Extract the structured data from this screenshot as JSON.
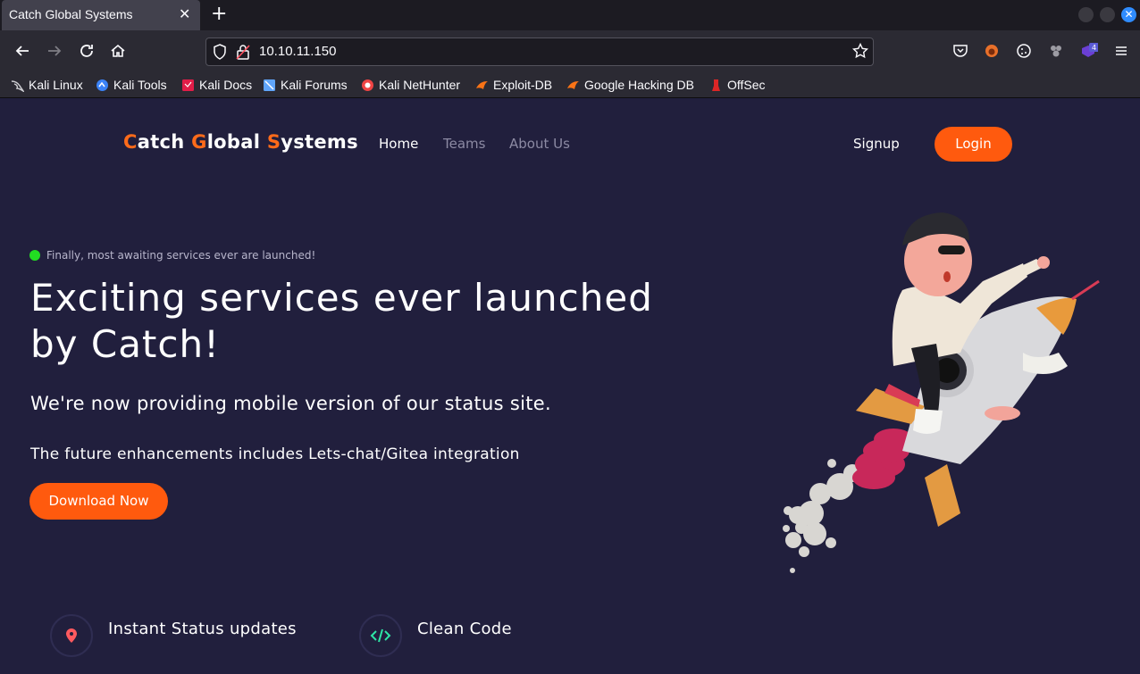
{
  "browser": {
    "tab_title": "Catch Global Systems",
    "tab_close": "✕",
    "new_tab": "+",
    "url": "10.10.11.150",
    "extension_badge": "4",
    "bookmarks": [
      {
        "label": "Kali Linux",
        "icon": "kali-dragon-icon",
        "color": "#cccccc"
      },
      {
        "label": "Kali Tools",
        "icon": "kali-tools-icon",
        "color": "#3b82f6"
      },
      {
        "label": "Kali Docs",
        "icon": "kali-docs-icon",
        "color": "#e11d48"
      },
      {
        "label": "Kali Forums",
        "icon": "kali-forums-icon",
        "color": "#60a5fa"
      },
      {
        "label": "Kali NetHunter",
        "icon": "nethunter-icon",
        "color": "#ef4444"
      },
      {
        "label": "Exploit-DB",
        "icon": "exploitdb-icon",
        "color": "#f97316"
      },
      {
        "label": "Google Hacking DB",
        "icon": "ghdb-icon",
        "color": "#f97316"
      },
      {
        "label": "OffSec",
        "icon": "offsec-icon",
        "color": "#dc2626"
      }
    ]
  },
  "site": {
    "brand": {
      "c1": "C",
      "r1": "atch ",
      "c2": "G",
      "r2": "lobal ",
      "c3": "S",
      "r3": "ystems"
    },
    "nav": {
      "home": "Home",
      "teams": "Teams",
      "about": "About Us"
    },
    "signup": "Signup",
    "login": "Login",
    "announcement": "Finally, most awaiting services ever are launched!",
    "headline": "Exciting services ever launched by Catch!",
    "subheading": "We're now providing mobile version of our status site.",
    "subheading2": "The future enhancements includes Lets-chat/Gitea integration",
    "download": "Download Now",
    "features": [
      {
        "title": "Instant Status updates",
        "icon": "map-pin-icon"
      },
      {
        "title": "Clean Code",
        "icon": "code-icon"
      }
    ]
  },
  "colors": {
    "accent": "#ff5a0e",
    "page_bg": "#211f3d",
    "status": "#22dd22"
  }
}
